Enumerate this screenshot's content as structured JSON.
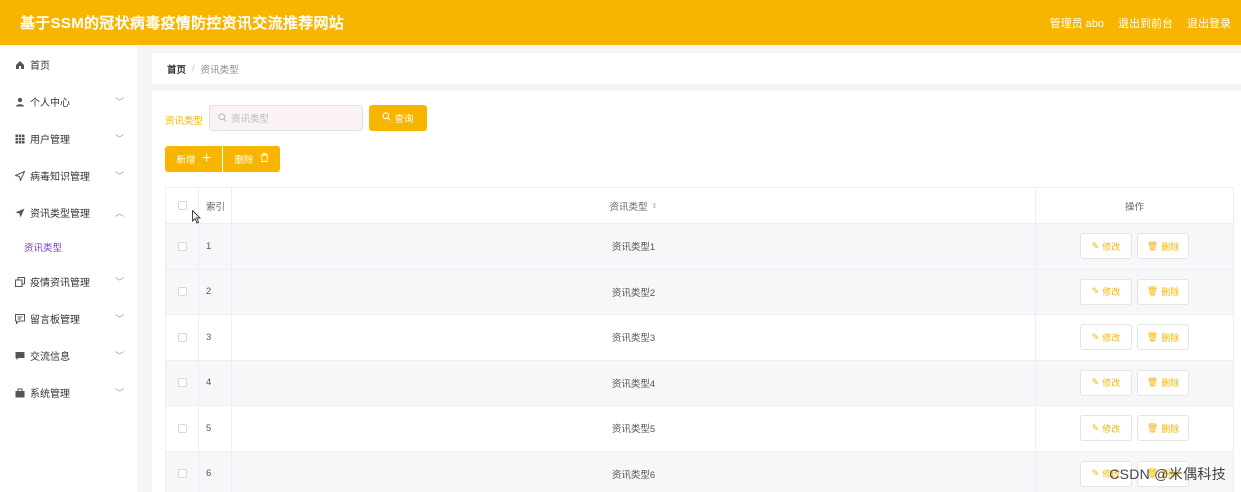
{
  "header": {
    "title": "基于SSM的冠状病毒疫情防控资讯交流推荐网站",
    "user": "管理员 abo",
    "front": "退出到前台",
    "logout": "退出登录"
  },
  "sidebar": {
    "items": [
      {
        "label": "首页",
        "icon": "home-icon"
      },
      {
        "label": "个人中心",
        "icon": "user-icon"
      },
      {
        "label": "用户管理",
        "icon": "grid-icon"
      },
      {
        "label": "病毒知识管理",
        "icon": "send-icon"
      },
      {
        "label": "资讯类型管理",
        "icon": "paper-plane-icon"
      },
      {
        "label": "疫情资讯管理",
        "icon": "copy-icon"
      },
      {
        "label": "留言板管理",
        "icon": "message-icon"
      },
      {
        "label": "交流信息",
        "icon": "chat-icon"
      },
      {
        "label": "系统管理",
        "icon": "briefcase-icon"
      }
    ],
    "sub_active": "资讯类型"
  },
  "breadcrumb": {
    "home": "首页",
    "sep": "/",
    "current": "资讯类型"
  },
  "search": {
    "label": "资讯类型",
    "placeholder": "资讯类型",
    "button": "查询"
  },
  "actions": {
    "add": "新增",
    "delete": "删除"
  },
  "table": {
    "headers": {
      "index": "索引",
      "type": "资讯类型",
      "ops": "操作"
    },
    "rows": [
      {
        "index": "1",
        "type": "资讯类型1"
      },
      {
        "index": "2",
        "type": "资讯类型2"
      },
      {
        "index": "3",
        "type": "资讯类型3"
      },
      {
        "index": "4",
        "type": "资讯类型4"
      },
      {
        "index": "5",
        "type": "资讯类型5"
      },
      {
        "index": "6",
        "type": "资讯类型6"
      }
    ],
    "edit_label": "修改",
    "delete_label": "删除"
  },
  "watermark": "CSDN @米偶科技",
  "colors": {
    "accent": "#f7b500",
    "active_sub": "#7b3fbf"
  }
}
